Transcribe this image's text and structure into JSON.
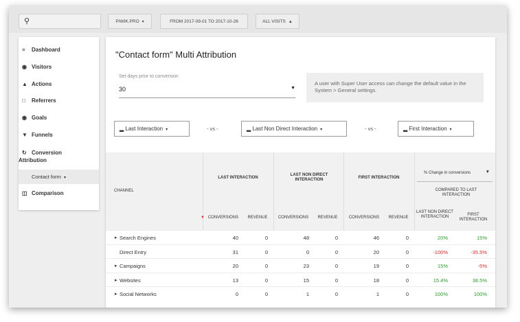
{
  "topbar": {
    "site_button": "PIWIK.PRO",
    "date_button": "FROM 2017-09-01 TO 2017-10-26",
    "segment_button": "ALL VISITS"
  },
  "sidebar": {
    "items": [
      {
        "label": "Dashboard",
        "icon": "list-icon"
      },
      {
        "label": "Visitors",
        "icon": "eye-icon"
      },
      {
        "label": "Actions",
        "icon": "bell-icon"
      },
      {
        "label": "Referrers",
        "icon": "calendar-icon"
      },
      {
        "label": "Goals",
        "icon": "target-icon"
      },
      {
        "label": "Funnels",
        "icon": "funnel-icon"
      },
      {
        "label": "Conversion Attribution",
        "icon": "refresh-icon"
      },
      {
        "label": "Comparison",
        "icon": "compare-icon"
      }
    ],
    "sub_item": "Contact form"
  },
  "page": {
    "title": "\"Contact form\" Multi Attribution",
    "days_label": "Set days prior to conversion",
    "days_value": "30",
    "info_text": "A user with Super User access can change the default value in the System > General settings."
  },
  "models": {
    "first": "Last Interaction",
    "second": "Last Non Direct Interaction",
    "third": "First Interaction",
    "vs": "- vs -"
  },
  "table": {
    "channel_header": "CHANNEL",
    "groups": [
      "LAST INTERACTION",
      "LAST NON DIRECT INTERACTION",
      "FIRST INTERACTION"
    ],
    "change_select": "% Change in conversions",
    "compared_to": "COMPARED TO LAST INTERACTION",
    "sub_conversions": "CONVERSIONS",
    "sub_revenue": "REVENUE",
    "sub_lnd": "LAST NON DIRECT INTERACTION",
    "sub_first": "FIRST INTERACTION",
    "rows": [
      {
        "channel": "Search Engines",
        "expandable": true,
        "c1": "40",
        "r1": "0",
        "c2": "48",
        "r2": "0",
        "c3": "46",
        "r3": "0",
        "p1": "20%",
        "p2": "15%"
      },
      {
        "channel": "Direct Entry",
        "expandable": false,
        "c1": "31",
        "r1": "0",
        "c2": "0",
        "r2": "0",
        "c3": "20",
        "r3": "0",
        "p1": "-100%",
        "p2": "-35.5%"
      },
      {
        "channel": "Campaigns",
        "expandable": true,
        "c1": "20",
        "r1": "0",
        "c2": "23",
        "r2": "0",
        "c3": "19",
        "r3": "0",
        "p1": "15%",
        "p2": "-5%"
      },
      {
        "channel": "Websites",
        "expandable": true,
        "c1": "13",
        "r1": "0",
        "c2": "15",
        "r2": "0",
        "c3": "18",
        "r3": "0",
        "p1": "15.4%",
        "p2": "38.5%"
      },
      {
        "channel": "Social Networks",
        "expandable": true,
        "c1": "0",
        "r1": "0",
        "c2": "1",
        "r2": "0",
        "c3": "1",
        "r3": "0",
        "p1": "100%",
        "p2": "100%"
      }
    ]
  },
  "colors": {
    "positive": "#2e9c2e",
    "negative": "#d42b2b",
    "sort_arrow": "#d42b2b"
  }
}
